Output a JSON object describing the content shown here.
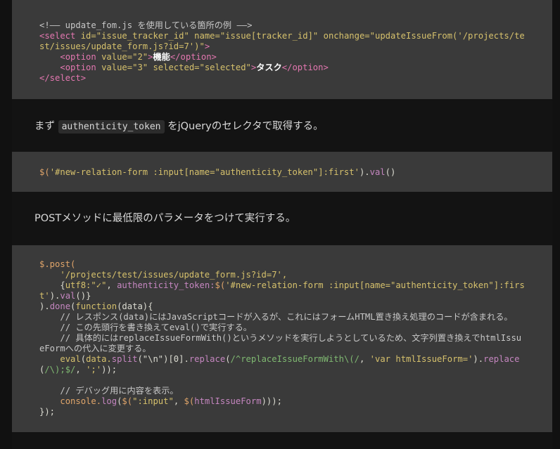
{
  "block1": {
    "comment": "<!—— update_fom.js を使用している箇所の例 ——>",
    "select_open_1": "<select",
    "attr_id": " id=",
    "val_id": "\"issue_tracker_id\"",
    "attr_name": " name=",
    "val_name": "\"issue[tracker_id]\"",
    "attr_onchange": " onchange=",
    "val_onchange": "\"updateIssueFrom('/projects/test/issues/update_form.js?id=7')\"",
    "select_open_close": ">",
    "opt1_open": "<option",
    "opt1_attr": " value=",
    "opt1_val": "\"2\"",
    "opt1_gt": ">",
    "opt1_text": "機能",
    "opt1_close": "</option>",
    "opt2_open": "<option",
    "opt2_attr": " value=",
    "opt2_val": "\"3\"",
    "opt2_attr2": " selected=",
    "opt2_val2": "\"selected\"",
    "opt2_gt": ">",
    "opt2_text": "タスク",
    "opt2_close": "</option>",
    "select_close": "</select>"
  },
  "prose1": {
    "before": "まず ",
    "code": "authenticity_token",
    "after": " をjQueryのセレクタで取得する。"
  },
  "block2": {
    "dollar": "$(",
    "selector": "'#new-relation-form :input[name=\"authenticity_token\"]:first'",
    "close": ").",
    "val": "val",
    "parens": "()"
  },
  "prose2": {
    "text": "POSTメソッドに最低限のパラメータをつけて実行する。"
  },
  "block3": {
    "post": "$.post(",
    "url": "'/projects/test/issues/update_form.js?id=7',",
    "obj_open": "{",
    "utf8_key": "utf8:",
    "utf8_val": "\"✓\"",
    "comma": ", ",
    "auth_key": "authenticity_token:",
    "auth_fn": "$(",
    "auth_sel": "'#new-relation-form :input[name=\"authenticity_token\"]:first'",
    "auth_close": ").",
    "auth_val": "val",
    "auth_end": "()}",
    "done_open": ").",
    "done": "done",
    "done_paren": "(",
    "function_kw": "function",
    "fn_args": "(data)",
    "fn_brace": "{",
    "c1": "// レスポンス(data)にはJavaScriptコードが入るが、これにはフォームHTML置き換え処理のコードが含まれる。",
    "c2": "// この先頭行を書き換えてeval()で実行する。",
    "c3": "// 具体的にはreplaceIssueFormWith()というメソッドを実行しようとしているため、文字列置き換えでhtmlIssueFormへの代入に変更する。",
    "eval": "eval",
    "eval_open": "(",
    "data_split": "data.",
    "split": "split",
    "split_arg": "(\"\\n\")",
    "idx": "[0].",
    "replace": "replace",
    "rep_open": "(",
    "regex": "/^replaceIssueFormWith\\(/",
    "rep_comma": ", ",
    "rep_str": "'var htmlIssueForm='",
    "rep_close": ").",
    "replace2": "replace",
    "rep2_open": "(",
    "regex2": "/\\);$/",
    "rep2_comma": ", ",
    "rep2_str": "';'",
    "rep2_close": "));",
    "c4": "// デバッグ用に内容を表示。",
    "console": "console.",
    "log": "log",
    "log_open": "(",
    "log_dollar": "$(",
    "log_sel": "\":input\"",
    "log_comma": ", ",
    "log_dollar2": "$(",
    "log_var": "htmlIssueForm",
    "log_close": ")));",
    "end": "});"
  }
}
